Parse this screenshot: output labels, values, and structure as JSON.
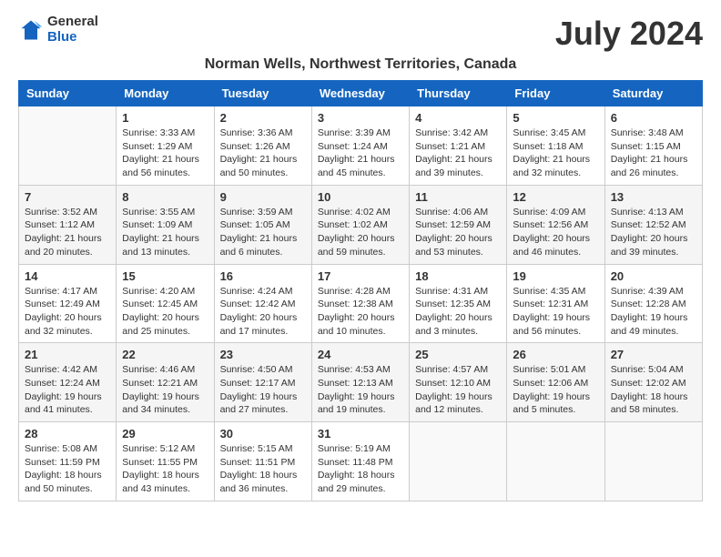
{
  "logo": {
    "general": "General",
    "blue": "Blue"
  },
  "title": "July 2024",
  "location": "Norman Wells, Northwest Territories, Canada",
  "days_of_week": [
    "Sunday",
    "Monday",
    "Tuesday",
    "Wednesday",
    "Thursday",
    "Friday",
    "Saturday"
  ],
  "weeks": [
    [
      {
        "day": "",
        "info": ""
      },
      {
        "day": "1",
        "info": "Sunrise: 3:33 AM\nSunset: 1:29 AM\nDaylight: 21 hours\nand 56 minutes."
      },
      {
        "day": "2",
        "info": "Sunrise: 3:36 AM\nSunset: 1:26 AM\nDaylight: 21 hours\nand 50 minutes."
      },
      {
        "day": "3",
        "info": "Sunrise: 3:39 AM\nSunset: 1:24 AM\nDaylight: 21 hours\nand 45 minutes."
      },
      {
        "day": "4",
        "info": "Sunrise: 3:42 AM\nSunset: 1:21 AM\nDaylight: 21 hours\nand 39 minutes."
      },
      {
        "day": "5",
        "info": "Sunrise: 3:45 AM\nSunset: 1:18 AM\nDaylight: 21 hours\nand 32 minutes."
      },
      {
        "day": "6",
        "info": "Sunrise: 3:48 AM\nSunset: 1:15 AM\nDaylight: 21 hours\nand 26 minutes."
      }
    ],
    [
      {
        "day": "7",
        "info": "Sunrise: 3:52 AM\nSunset: 1:12 AM\nDaylight: 21 hours\nand 20 minutes."
      },
      {
        "day": "8",
        "info": "Sunrise: 3:55 AM\nSunset: 1:09 AM\nDaylight: 21 hours\nand 13 minutes."
      },
      {
        "day": "9",
        "info": "Sunrise: 3:59 AM\nSunset: 1:05 AM\nDaylight: 21 hours\nand 6 minutes."
      },
      {
        "day": "10",
        "info": "Sunrise: 4:02 AM\nSunset: 1:02 AM\nDaylight: 20 hours\nand 59 minutes."
      },
      {
        "day": "11",
        "info": "Sunrise: 4:06 AM\nSunset: 12:59 AM\nDaylight: 20 hours\nand 53 minutes."
      },
      {
        "day": "12",
        "info": "Sunrise: 4:09 AM\nSunset: 12:56 AM\nDaylight: 20 hours\nand 46 minutes."
      },
      {
        "day": "13",
        "info": "Sunrise: 4:13 AM\nSunset: 12:52 AM\nDaylight: 20 hours\nand 39 minutes."
      }
    ],
    [
      {
        "day": "14",
        "info": "Sunrise: 4:17 AM\nSunset: 12:49 AM\nDaylight: 20 hours\nand 32 minutes."
      },
      {
        "day": "15",
        "info": "Sunrise: 4:20 AM\nSunset: 12:45 AM\nDaylight: 20 hours\nand 25 minutes."
      },
      {
        "day": "16",
        "info": "Sunrise: 4:24 AM\nSunset: 12:42 AM\nDaylight: 20 hours\nand 17 minutes."
      },
      {
        "day": "17",
        "info": "Sunrise: 4:28 AM\nSunset: 12:38 AM\nDaylight: 20 hours\nand 10 minutes."
      },
      {
        "day": "18",
        "info": "Sunrise: 4:31 AM\nSunset: 12:35 AM\nDaylight: 20 hours\nand 3 minutes."
      },
      {
        "day": "19",
        "info": "Sunrise: 4:35 AM\nSunset: 12:31 AM\nDaylight: 19 hours\nand 56 minutes."
      },
      {
        "day": "20",
        "info": "Sunrise: 4:39 AM\nSunset: 12:28 AM\nDaylight: 19 hours\nand 49 minutes."
      }
    ],
    [
      {
        "day": "21",
        "info": "Sunrise: 4:42 AM\nSunset: 12:24 AM\nDaylight: 19 hours\nand 41 minutes."
      },
      {
        "day": "22",
        "info": "Sunrise: 4:46 AM\nSunset: 12:21 AM\nDaylight: 19 hours\nand 34 minutes."
      },
      {
        "day": "23",
        "info": "Sunrise: 4:50 AM\nSunset: 12:17 AM\nDaylight: 19 hours\nand 27 minutes."
      },
      {
        "day": "24",
        "info": "Sunrise: 4:53 AM\nSunset: 12:13 AM\nDaylight: 19 hours\nand 19 minutes."
      },
      {
        "day": "25",
        "info": "Sunrise: 4:57 AM\nSunset: 12:10 AM\nDaylight: 19 hours\nand 12 minutes."
      },
      {
        "day": "26",
        "info": "Sunrise: 5:01 AM\nSunset: 12:06 AM\nDaylight: 19 hours\nand 5 minutes."
      },
      {
        "day": "27",
        "info": "Sunrise: 5:04 AM\nSunset: 12:02 AM\nDaylight: 18 hours\nand 58 minutes."
      }
    ],
    [
      {
        "day": "28",
        "info": "Sunrise: 5:08 AM\nSunset: 11:59 PM\nDaylight: 18 hours\nand 50 minutes."
      },
      {
        "day": "29",
        "info": "Sunrise: 5:12 AM\nSunset: 11:55 PM\nDaylight: 18 hours\nand 43 minutes."
      },
      {
        "day": "30",
        "info": "Sunrise: 5:15 AM\nSunset: 11:51 PM\nDaylight: 18 hours\nand 36 minutes."
      },
      {
        "day": "31",
        "info": "Sunrise: 5:19 AM\nSunset: 11:48 PM\nDaylight: 18 hours\nand 29 minutes."
      },
      {
        "day": "",
        "info": ""
      },
      {
        "day": "",
        "info": ""
      },
      {
        "day": "",
        "info": ""
      }
    ]
  ],
  "row_colors": [
    "white",
    "shade",
    "white",
    "shade",
    "white"
  ]
}
